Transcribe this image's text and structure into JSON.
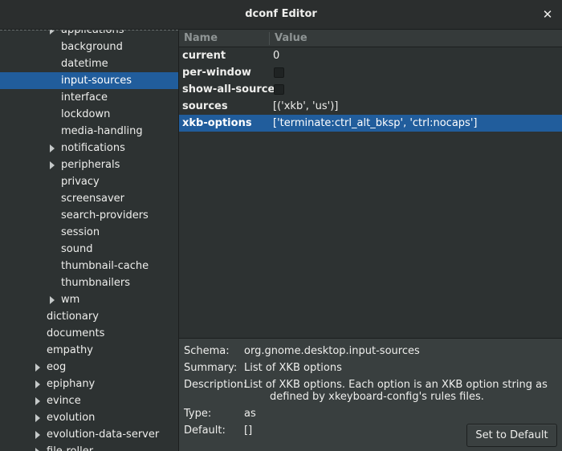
{
  "window": {
    "title": "dconf Editor"
  },
  "tree": {
    "items": [
      {
        "label": "applications",
        "level": 3,
        "expandable": true,
        "selected": false
      },
      {
        "label": "background",
        "level": 3,
        "expandable": false,
        "selected": false
      },
      {
        "label": "datetime",
        "level": 3,
        "expandable": false,
        "selected": false
      },
      {
        "label": "input-sources",
        "level": 3,
        "expandable": false,
        "selected": true
      },
      {
        "label": "interface",
        "level": 3,
        "expandable": false,
        "selected": false
      },
      {
        "label": "lockdown",
        "level": 3,
        "expandable": false,
        "selected": false
      },
      {
        "label": "media-handling",
        "level": 3,
        "expandable": false,
        "selected": false
      },
      {
        "label": "notifications",
        "level": 3,
        "expandable": true,
        "selected": false
      },
      {
        "label": "peripherals",
        "level": 3,
        "expandable": true,
        "selected": false
      },
      {
        "label": "privacy",
        "level": 3,
        "expandable": false,
        "selected": false
      },
      {
        "label": "screensaver",
        "level": 3,
        "expandable": false,
        "selected": false
      },
      {
        "label": "search-providers",
        "level": 3,
        "expandable": false,
        "selected": false
      },
      {
        "label": "session",
        "level": 3,
        "expandable": false,
        "selected": false
      },
      {
        "label": "sound",
        "level": 3,
        "expandable": false,
        "selected": false
      },
      {
        "label": "thumbnail-cache",
        "level": 3,
        "expandable": false,
        "selected": false
      },
      {
        "label": "thumbnailers",
        "level": 3,
        "expandable": false,
        "selected": false
      },
      {
        "label": "wm",
        "level": 3,
        "expandable": true,
        "selected": false
      },
      {
        "label": "dictionary",
        "level": 2,
        "expandable": false,
        "selected": false
      },
      {
        "label": "documents",
        "level": 2,
        "expandable": false,
        "selected": false
      },
      {
        "label": "empathy",
        "level": 2,
        "expandable": false,
        "selected": false
      },
      {
        "label": "eog",
        "level": 2,
        "expandable": true,
        "selected": false
      },
      {
        "label": "epiphany",
        "level": 2,
        "expandable": true,
        "selected": false
      },
      {
        "label": "evince",
        "level": 2,
        "expandable": true,
        "selected": false
      },
      {
        "label": "evolution",
        "level": 2,
        "expandable": true,
        "selected": false
      },
      {
        "label": "evolution-data-server",
        "level": 2,
        "expandable": true,
        "selected": false
      },
      {
        "label": "file-roller",
        "level": 2,
        "expandable": true,
        "selected": false
      }
    ]
  },
  "keys": {
    "header": {
      "name": "Name",
      "value": "Value"
    },
    "rows": [
      {
        "name": "current",
        "type": "text",
        "value": "0",
        "selected": false
      },
      {
        "name": "per-window",
        "type": "checkbox",
        "value": "",
        "checked": false,
        "selected": false
      },
      {
        "name": "show-all-sources",
        "type": "checkbox",
        "value": "",
        "checked": false,
        "selected": false
      },
      {
        "name": "sources",
        "type": "text",
        "value": "[('xkb', 'us')]",
        "selected": false
      },
      {
        "name": "xkb-options",
        "type": "text",
        "value": "['terminate:ctrl_alt_bksp', 'ctrl:nocaps']",
        "selected": true
      }
    ]
  },
  "details": {
    "schema_label": "Schema:",
    "schema_value": "org.gnome.desktop.input-sources",
    "summary_label": "Summary:",
    "summary_value": "List of XKB options",
    "description_label": "Description:",
    "description_line1": "List of XKB options. Each option is an XKB option string as",
    "description_line2": "defined by xkeyboard-config's rules files.",
    "type_label": "Type:",
    "type_value": "as",
    "default_label": "Default:",
    "default_value": "[]",
    "reset_button": "Set to Default"
  },
  "colors": {
    "selection": "#215d9c",
    "background": "#393f3f",
    "list_background": "#2d3232",
    "text": "#eeeeec"
  }
}
